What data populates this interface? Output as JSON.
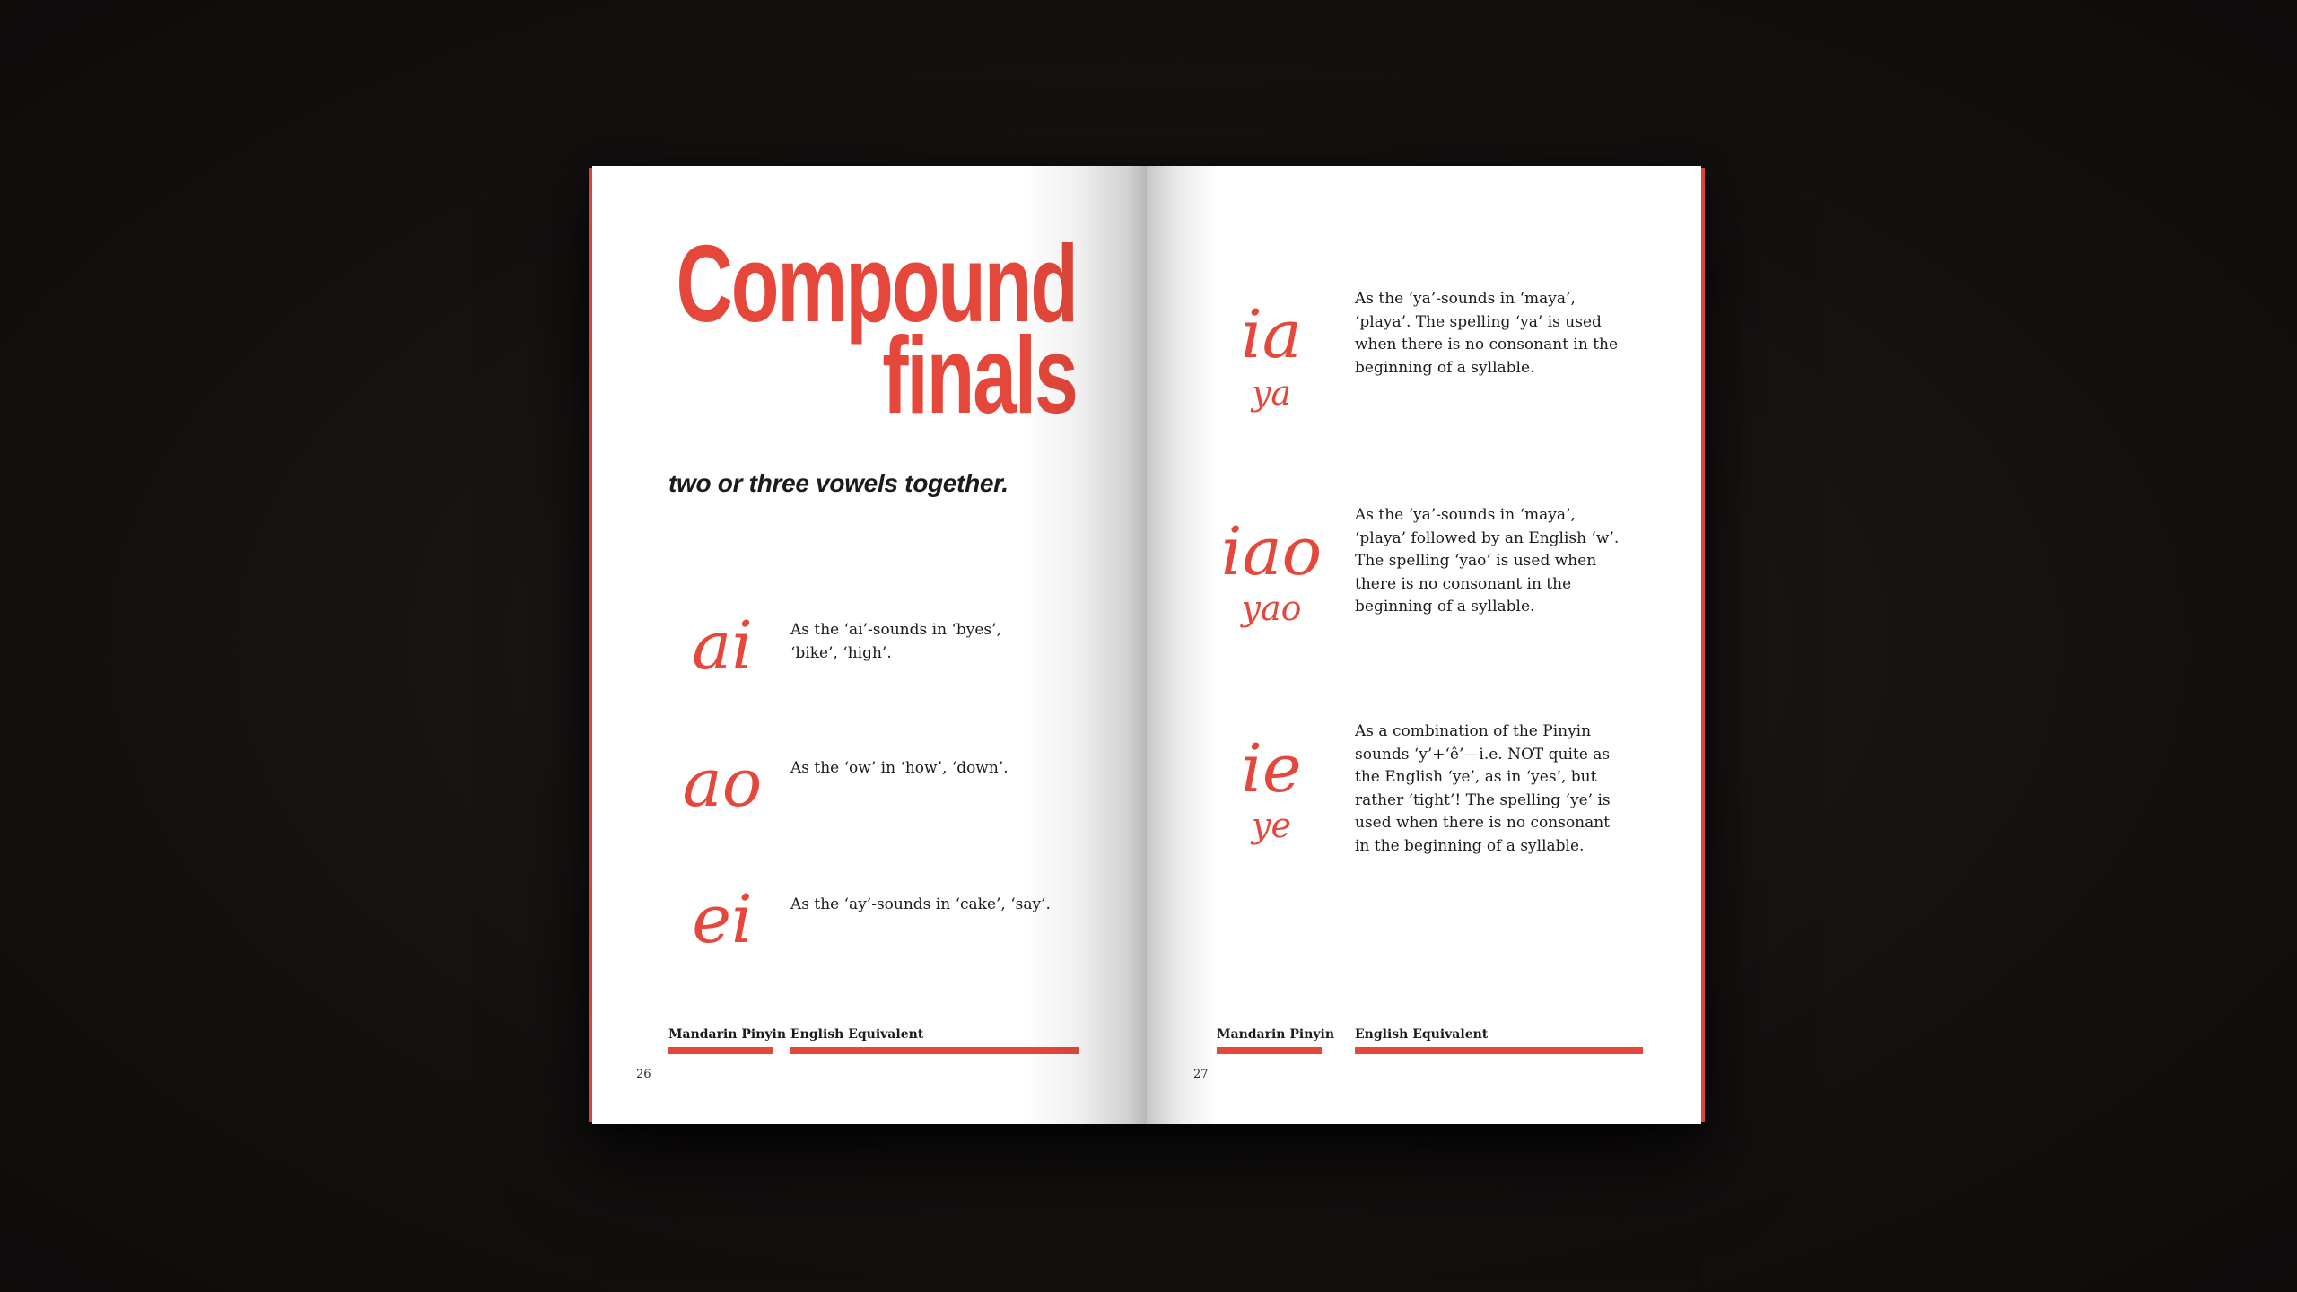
{
  "left_page": {
    "title_line1": "Compound",
    "title_line2": "finals",
    "subtitle": "two or three vowels together.",
    "entries": [
      {
        "pinyin": "ai",
        "description": "As the ‘ai’-sounds in ‘byes’,\n‘bike’, ‘high’."
      },
      {
        "pinyin": "ao",
        "description": "As the ‘ow’ in ‘how’, ‘down’."
      },
      {
        "pinyin": "ei",
        "description": "As the ‘ay’-sounds in ‘cake’, ‘say’."
      }
    ],
    "footer": {
      "col1": "Mandarin Pinyin",
      "col2": "English Equivalent"
    },
    "page_number": "26"
  },
  "right_page": {
    "entries": [
      {
        "pinyin": "ia",
        "spelling": "ya",
        "description": "As the ‘ya’-sounds in ‘maya’,\n‘playa’. The spelling ‘ya’ is used\nwhen there is no consonant in the\nbeginning of a syllable."
      },
      {
        "pinyin": "iao",
        "spelling": "yao",
        "description": "As the ‘ya’-sounds in ‘maya’,\n‘playa’ followed by an English ‘w’.\nThe spelling ‘yao’ is used when\nthere is no consonant in the\nbeginning of a syllable."
      },
      {
        "pinyin": "ie",
        "spelling": "ye",
        "description": "As a combination of the Pinyin\nsounds ‘y’+‘ê’—i.e. NOT quite as\nthe English ‘ye’, as in ‘yes’, but\nrather ‘tight’! The spelling ‘ye’ is\nused when there is no consonant\nin the beginning of a syllable."
      }
    ],
    "footer": {
      "col1": "Mandarin Pinyin",
      "col2": "English Equivalent"
    },
    "page_number": "27"
  },
  "colors": {
    "accent": "#e5483a",
    "text": "#1b1b1b",
    "page": "#ffffff",
    "background": "#141110"
  }
}
